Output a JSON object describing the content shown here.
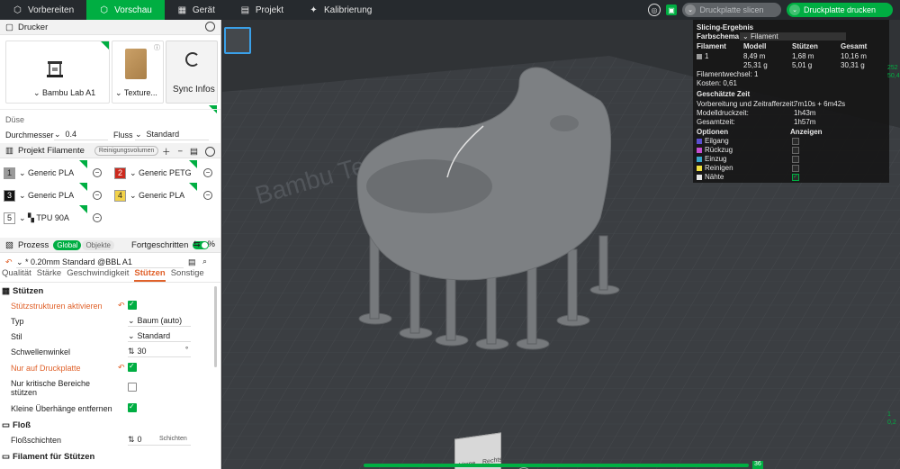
{
  "topbar": {
    "tabs": [
      {
        "label": "Vorbereiten",
        "icon": "cube-icon"
      },
      {
        "label": "Vorschau",
        "icon": "preview-icon",
        "active": true
      },
      {
        "label": "Gerät",
        "icon": "device-icon"
      },
      {
        "label": "Projekt",
        "icon": "project-icon"
      },
      {
        "label": "Kalibrierung",
        "icon": "calibration-icon"
      }
    ],
    "slice_label": "Druckplatte slicen",
    "print_label": "Druckplatte drucken"
  },
  "printer": {
    "header": "Drucker",
    "printer_name": "Bambu Lab A1",
    "plate_name": "Texture...",
    "sync_label": "Sync Infos",
    "nozzle_header": "Düse",
    "diameter_label": "Durchmesser",
    "diameter_value": "0.4",
    "flow_label": "Fluss",
    "flow_value": "Standard"
  },
  "filaments": {
    "header": "Projekt Filamente",
    "purge_label": "Reinigungsvolumen",
    "items": [
      {
        "num": "1",
        "name": "Generic PLA",
        "color": "#9a9a9a"
      },
      {
        "num": "2",
        "name": "Generic PETG",
        "color": "#cc2a1e"
      },
      {
        "num": "3",
        "name": "Generic PLA",
        "color": "#111111"
      },
      {
        "num": "4",
        "name": "Generic PLA",
        "color": "#f2d24a"
      },
      {
        "num": "5",
        "name": "TPU 90A",
        "color": "#ffffff"
      }
    ]
  },
  "process": {
    "header": "Prozess",
    "global_label": "Global",
    "objects_label": "Objekte",
    "advanced_label": "Fortgeschritten",
    "preset": "* 0.20mm Standard @BBL A1",
    "tabs": [
      "Qualität",
      "Stärke",
      "Geschwindigkeit",
      "Stützen",
      "Sonstige"
    ],
    "support_header": "Stützen",
    "rows": {
      "enable": "Stützstrukturen aktivieren",
      "type_label": "Typ",
      "type_value": "Baum (auto)",
      "style_label": "Stil",
      "style_value": "Standard",
      "threshold_label": "Schwellenwinkel",
      "threshold_value": "30",
      "threshold_unit": "°",
      "build_plate_label": "Nur auf Druckplatte",
      "critical_label": "Nur kritische Bereiche stützen",
      "remove_label": "Kleine Überhänge entfernen"
    },
    "raft_header": "Floß",
    "raft_layers_label": "Floßschichten",
    "raft_layers_value": "0",
    "raft_layers_unit": "Schichten",
    "filament_support_header": "Filament für Stützen"
  },
  "result": {
    "title": "Slicing-Ergebnis",
    "scheme_label": "Farbschema",
    "scheme_value": "Filament",
    "columns": [
      "Filament",
      "Modell",
      "Stützen",
      "Gesamt"
    ],
    "row1": {
      "id": "1",
      "model_m": "8,49 m",
      "model_g": "25,31 g",
      "support_m": "1,68 m",
      "support_g": "5,01 g",
      "total_m": "10,16 m",
      "total_g": "30,31 g"
    },
    "changes": "Filamentwechsel: 1",
    "cost": "Kosten: 0,61",
    "time_title": "Geschätzte Zeit",
    "prep_label": "Vorbereitung und Zeitrafferzeit:",
    "prep_value": "7m10s + 6m42s",
    "model_time_label": "Modelldruckzeit:",
    "model_time_value": "1h43m",
    "total_time_label": "Gesamtzeit:",
    "total_time_value": "1h57m",
    "options_label": "Optionen",
    "show_label": "Anzeigen",
    "options": [
      {
        "name": "Eilgang",
        "color": "#5a4fcf",
        "on": false
      },
      {
        "name": "Rückzug",
        "color": "#c44fd0",
        "on": false
      },
      {
        "name": "Einzug",
        "color": "#3aa6c9",
        "on": false
      },
      {
        "name": "Reinigen",
        "color": "#f0e040",
        "on": false
      },
      {
        "name": "Nähte",
        "color": "#e6e6e6",
        "on": true
      }
    ]
  },
  "viewport": {
    "plate_text": "Bambu Textured PEI Plate",
    "cube_front": "Vorne",
    "cube_right": "Rechts",
    "layer_top": "36",
    "axis_top": "252",
    "axis_top2": "50,4",
    "axis_bottom": "1",
    "axis_bottom2": "0,2"
  }
}
